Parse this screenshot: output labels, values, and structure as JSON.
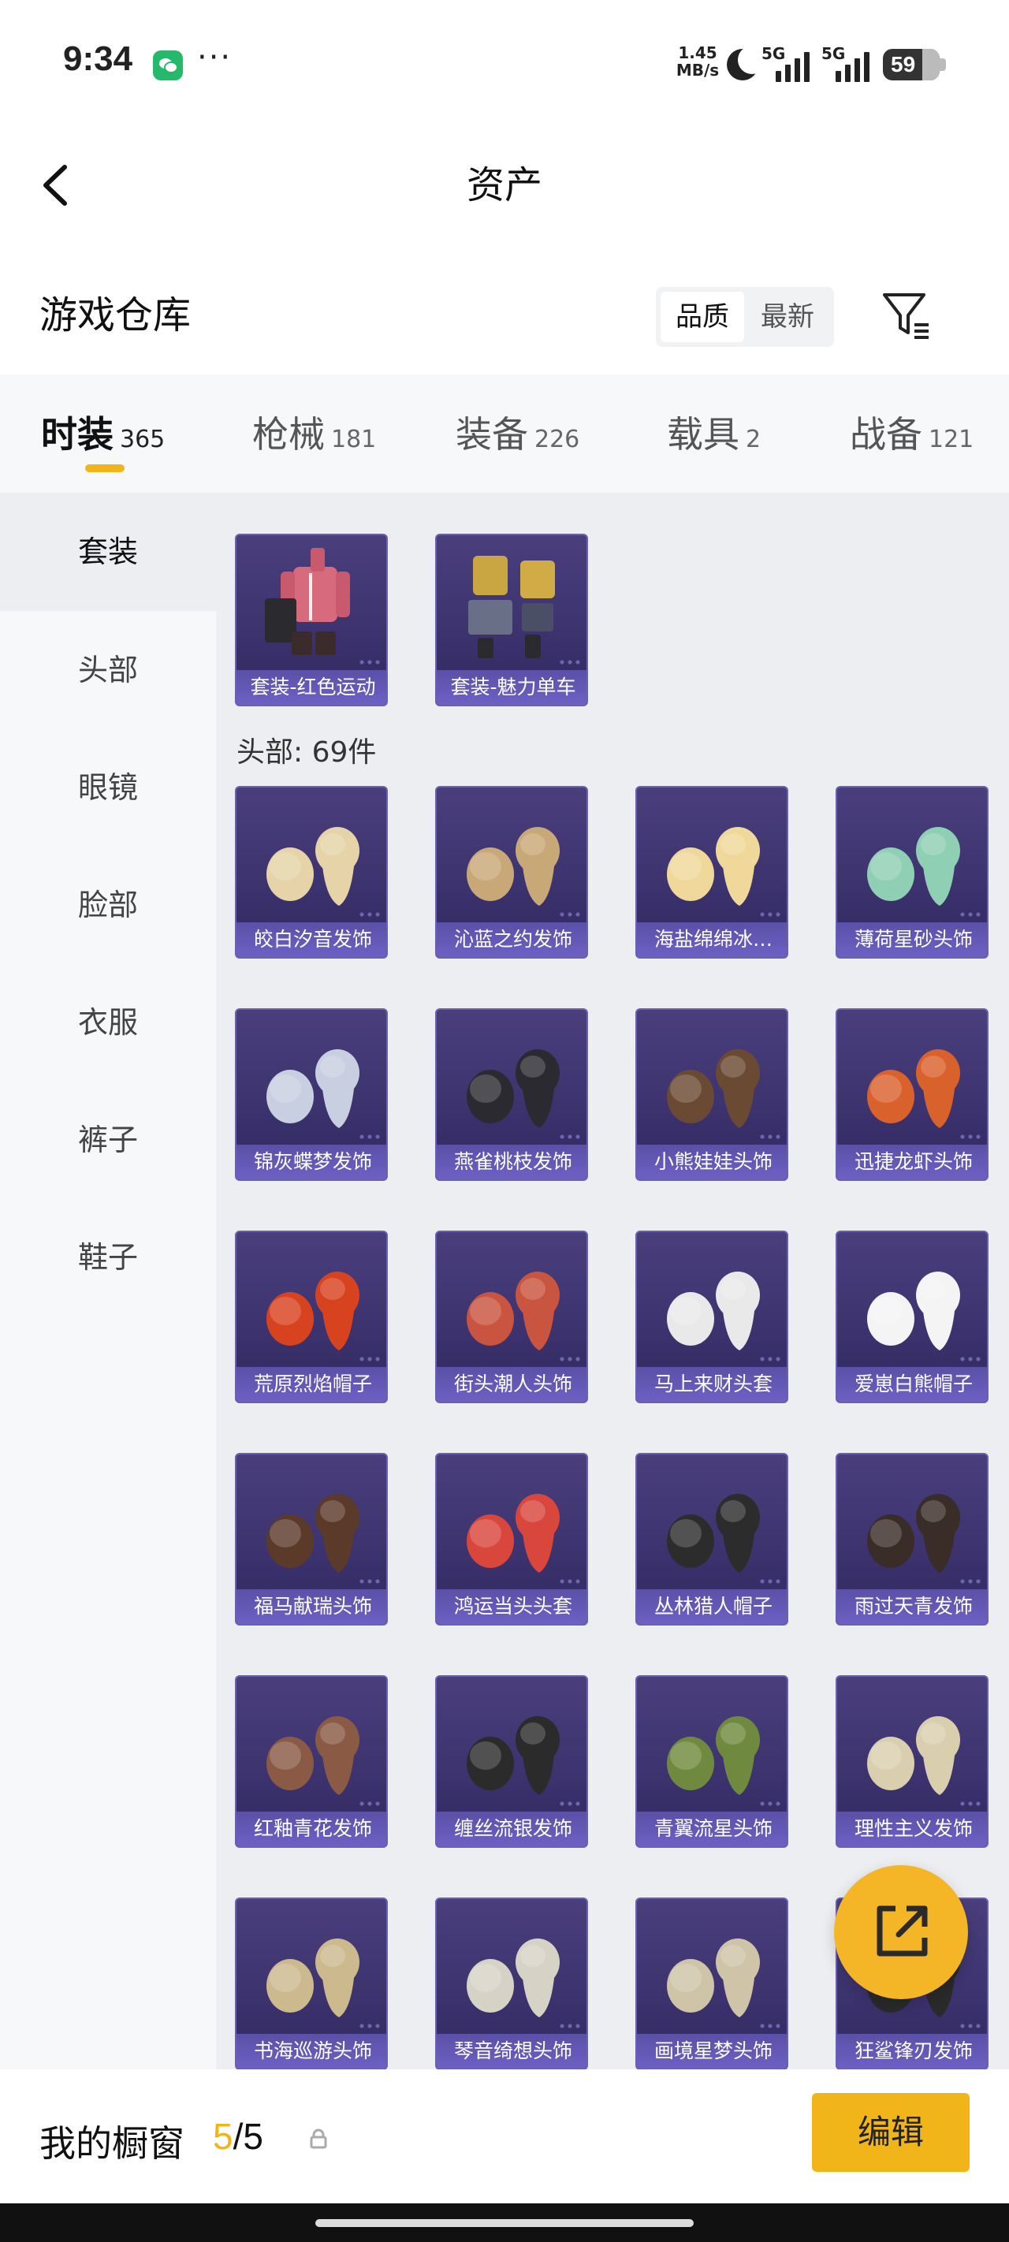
{
  "status_bar": {
    "time": "9:34",
    "net_speed_value": "1.45",
    "net_speed_unit": "MB/s",
    "signal_1": "5G",
    "signal_2": "5G",
    "battery": "59"
  },
  "nav": {
    "title": "资产"
  },
  "warehouse": {
    "title": "游戏仓库",
    "sort_options": [
      "品质",
      "最新"
    ],
    "sort_selected": "品质"
  },
  "tabs": [
    {
      "name": "时装",
      "count": "365"
    },
    {
      "name": "枪械",
      "count": "181"
    },
    {
      "name": "装备",
      "count": "226"
    },
    {
      "name": "载具",
      "count": "2"
    },
    {
      "name": "战备",
      "count": "121"
    }
  ],
  "sidebar": {
    "items": [
      "套装",
      "头部",
      "眼镜",
      "脸部",
      "衣服",
      "裤子",
      "鞋子"
    ],
    "active": "套装"
  },
  "sets": [
    {
      "label": "套装-红色运动",
      "icon": "red-sport-outfit"
    },
    {
      "label": "套装-魅力单车",
      "icon": "yellow-cycling-outfit"
    }
  ],
  "head_section": {
    "heading": "头部: 69件",
    "items": [
      {
        "label": "皎白汐音发饰",
        "color": "#e6d3a8"
      },
      {
        "label": "沁蓝之约发饰",
        "color": "#c9a877"
      },
      {
        "label": "海盐绵绵冰…",
        "color": "#f0d89a"
      },
      {
        "label": "薄荷星砂头饰",
        "color": "#8fcfb3"
      },
      {
        "label": "锦灰蝶梦发饰",
        "color": "#c7cfe0"
      },
      {
        "label": "燕雀桃枝发饰",
        "color": "#2a2a30"
      },
      {
        "label": "小熊娃娃头饰",
        "color": "#6b4a33"
      },
      {
        "label": "迅捷龙虾头饰",
        "color": "#d9612c"
      },
      {
        "label": "荒原烈焰帽子",
        "color": "#d8431f"
      },
      {
        "label": "街头潮人头饰",
        "color": "#c95540"
      },
      {
        "label": "马上来财头套",
        "color": "#e9e9e9"
      },
      {
        "label": "爱崽白熊帽子",
        "color": "#f4f4f4"
      },
      {
        "label": "福马献瑞头饰",
        "color": "#5b3a2a"
      },
      {
        "label": "鸿运当头头套",
        "color": "#d9463c"
      },
      {
        "label": "丛林猎人帽子",
        "color": "#2c2c2c"
      },
      {
        "label": "雨过天青发饰",
        "color": "#3a2c26"
      },
      {
        "label": "红釉青花发饰",
        "color": "#8a5a45"
      },
      {
        "label": "缠丝流银发饰",
        "color": "#2b2b2b"
      },
      {
        "label": "青翼流星头饰",
        "color": "#6f8a3e"
      },
      {
        "label": "理性主义发饰",
        "color": "#d9cfae"
      },
      {
        "label": "书海巡游头饰",
        "color": "#cdb98e"
      },
      {
        "label": "琴音绮想头饰",
        "color": "#d6d2c6"
      },
      {
        "label": "画境星梦头饰",
        "color": "#cfc4a8"
      },
      {
        "label": "狂鲨锋刃发饰",
        "color": "#2a2a2a"
      }
    ]
  },
  "bottom": {
    "label": "我的橱窗",
    "current": "5",
    "separator": "/",
    "total": "5",
    "edit_label": "编辑"
  },
  "colors": {
    "accent": "#f2b519",
    "card_bg": "#3b326e",
    "card_label_bg": "#6d60c4"
  }
}
